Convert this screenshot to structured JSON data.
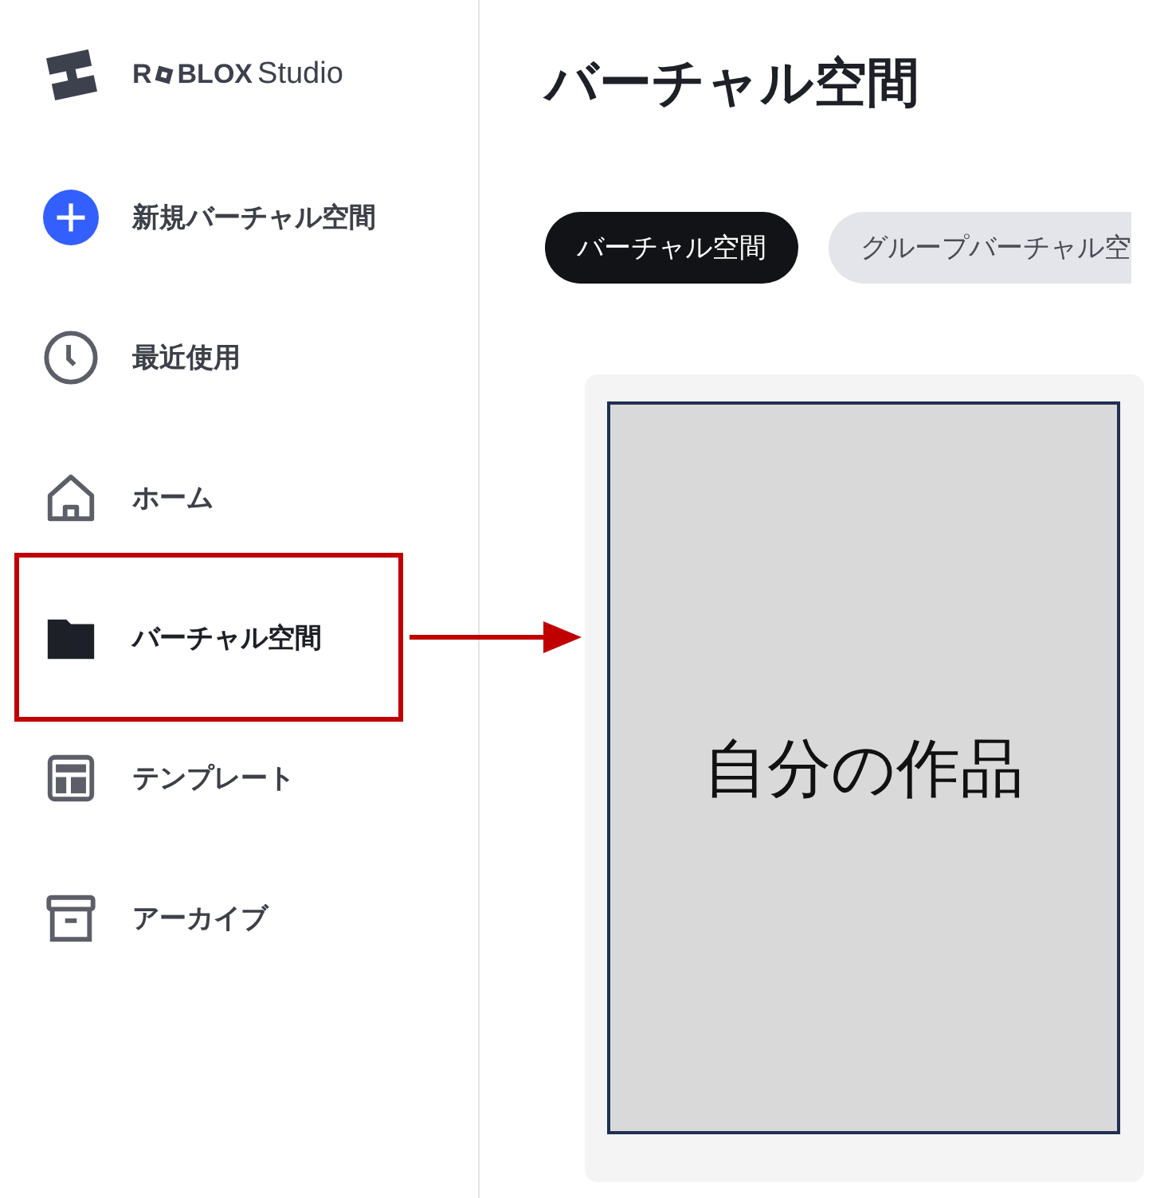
{
  "logo": {
    "letter": "R",
    "word": "BLOX",
    "product": "Studio"
  },
  "sidebar": {
    "items": [
      {
        "kind": "create",
        "label": "新規バーチャル空間",
        "selected": false
      },
      {
        "kind": "recent",
        "label": "最近使用",
        "selected": false
      },
      {
        "kind": "home",
        "label": "ホーム",
        "selected": false
      },
      {
        "kind": "folder",
        "label": "バーチャル空間",
        "selected": true
      },
      {
        "kind": "template",
        "label": "テンプレート",
        "selected": false
      },
      {
        "kind": "archive",
        "label": "アーカイブ",
        "selected": false
      }
    ]
  },
  "page_title": "バーチャル空間",
  "filters": [
    {
      "label": "バーチャル空間",
      "selected": true
    },
    {
      "label": "グループバーチャル空",
      "selected": false
    }
  ],
  "card": {
    "label": "自分の作品"
  }
}
